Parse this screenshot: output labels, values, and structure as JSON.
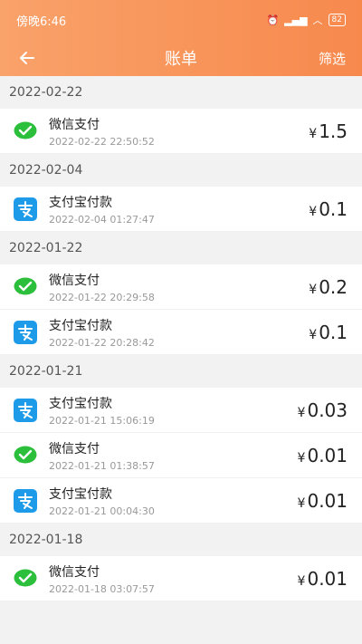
{
  "statusbar": {
    "time": "傍晚6:46",
    "battery": "82"
  },
  "topbar": {
    "title": "账单",
    "filter_label": "筛选"
  },
  "colors": {
    "header": "#f7894d",
    "wechat": "#2bbf3c",
    "alipay": "#1e9be8"
  },
  "sections": [
    {
      "date": "2022-02-22",
      "items": [
        {
          "icon": "wechat-pay-icon",
          "name": "微信支付",
          "time": "2022-02-22 22:50:52",
          "currency": "¥",
          "amount": "1.5"
        }
      ]
    },
    {
      "date": "2022-02-04",
      "items": [
        {
          "icon": "alipay-icon",
          "name": "支付宝付款",
          "time": "2022-02-04 01:27:47",
          "currency": "¥",
          "amount": "0.1"
        }
      ]
    },
    {
      "date": "2022-01-22",
      "items": [
        {
          "icon": "wechat-pay-icon",
          "name": "微信支付",
          "time": "2022-01-22 20:29:58",
          "currency": "¥",
          "amount": "0.2"
        },
        {
          "icon": "alipay-icon",
          "name": "支付宝付款",
          "time": "2022-01-22 20:28:42",
          "currency": "¥",
          "amount": "0.1"
        }
      ]
    },
    {
      "date": "2022-01-21",
      "items": [
        {
          "icon": "alipay-icon",
          "name": "支付宝付款",
          "time": "2022-01-21 15:06:19",
          "currency": "¥",
          "amount": "0.03"
        },
        {
          "icon": "wechat-pay-icon",
          "name": "微信支付",
          "time": "2022-01-21 01:38:57",
          "currency": "¥",
          "amount": "0.01"
        },
        {
          "icon": "alipay-icon",
          "name": "支付宝付款",
          "time": "2022-01-21 00:04:30",
          "currency": "¥",
          "amount": "0.01"
        }
      ]
    },
    {
      "date": "2022-01-18",
      "items": [
        {
          "icon": "wechat-pay-icon",
          "name": "微信支付",
          "time": "2022-01-18 03:07:57",
          "currency": "¥",
          "amount": "0.01"
        }
      ]
    }
  ]
}
